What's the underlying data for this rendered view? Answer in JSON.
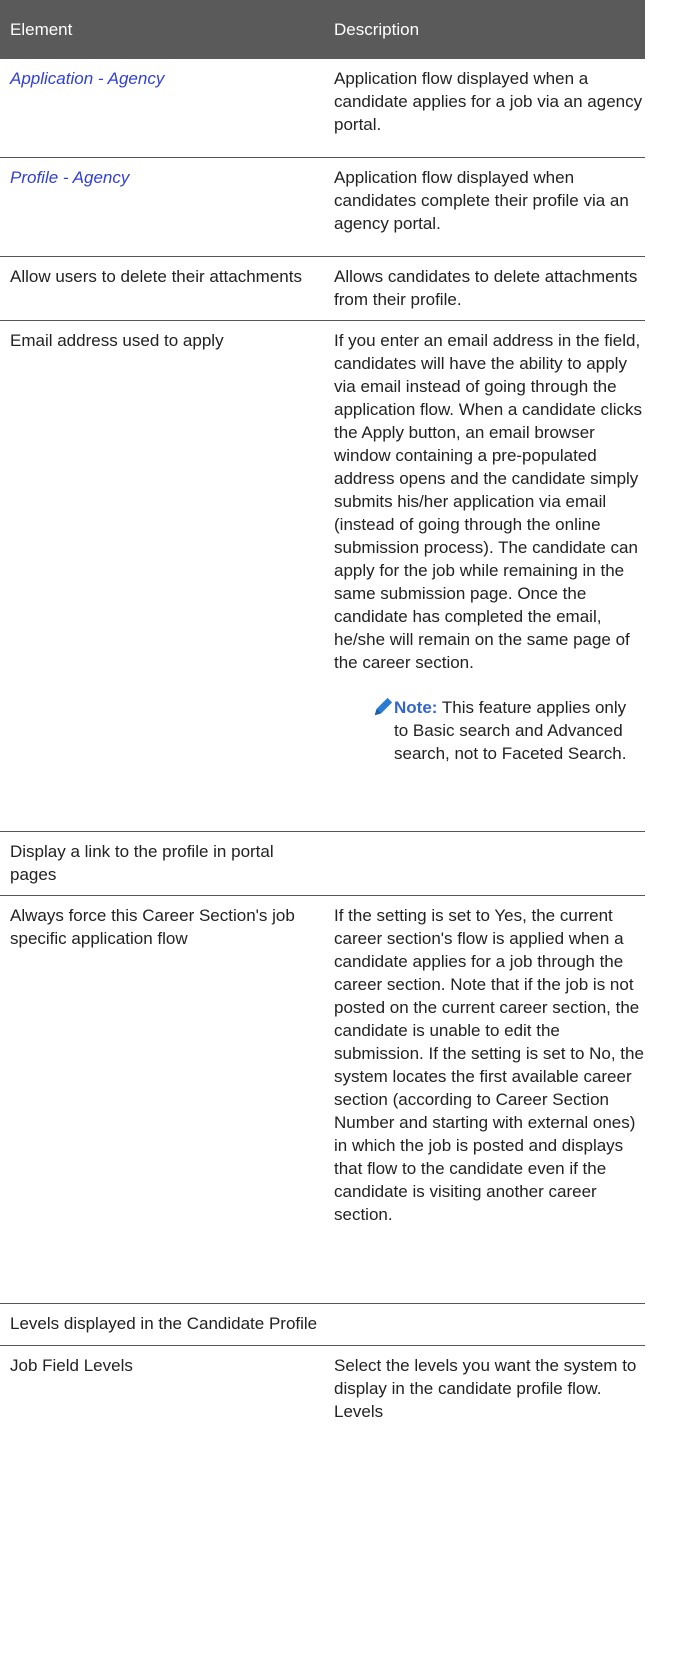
{
  "header": {
    "element_label": "Element",
    "description_label": "Description"
  },
  "rows": [
    {
      "element": "Application - Agency",
      "description": "Application flow displayed when a candidate applies for a job via an agency portal."
    },
    {
      "element": "Profile - Agency",
      "description": "Application flow displayed when candidates complete their profile via an agency portal."
    },
    {
      "element": "Allow users to delete their attachments",
      "description": "Allows candidates to delete attachments from their profile."
    },
    {
      "element": "Email address used to apply",
      "description": "If you enter an email address in the field, candidates will have the ability to apply via email instead of going through the application flow. When a candidate clicks the Apply button, an email browser window containing a pre-populated address opens and the candidate simply submits his/her application via email (instead of going through the online submission process). The candidate can apply for the job while remaining in the same submission page. Once the candidate has completed the email, he/she will remain on the same page of the career section.",
      "note_label": "Note:",
      "note_text": "This feature applies only to Basic search and Advanced search, not to Faceted Search."
    },
    {
      "element": "Display a link to the profile in portal pages"
    },
    {
      "element": "Always force this Career Section's job specific application flow",
      "description": "If the setting is set to Yes, the current career section's flow is applied when a candidate applies for a job through the career section. Note that if the job is not posted on the current career section, the candidate is unable to edit the submission. If the setting is set to No, the system locates the first available career section (according to Career Section Number and starting with external ones) in which the job is posted and displays that flow to the candidate even if the candidate is visiting another career section."
    },
    {
      "element": "Levels displayed in the Candidate Profile"
    },
    {
      "element": "Job Field Levels",
      "description": "Select the levels you want the system to display in the candidate profile flow. Levels"
    }
  ],
  "icons": {
    "note_icon": "pencil-icon",
    "note_icon_color": "#2a7bd4"
  },
  "colors": {
    "header_bg": "#5a5a5a",
    "link": "#2f3fd8",
    "note_label": "#3366cc"
  }
}
